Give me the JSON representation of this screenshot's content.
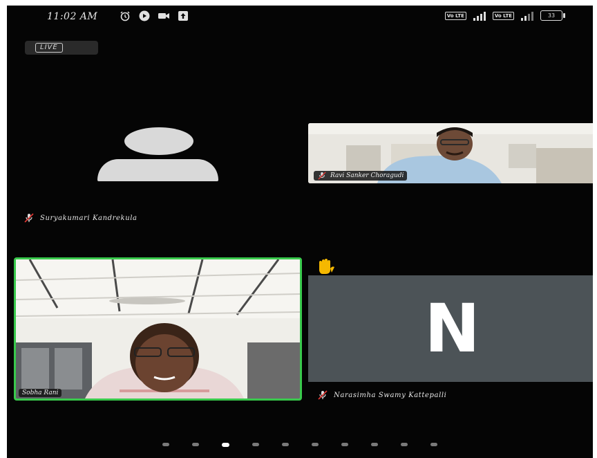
{
  "status_bar": {
    "time": "11:02 AM",
    "icons_left": [
      "alarm-icon",
      "youtube-icon",
      "video-camera-icon",
      "upload-icon"
    ],
    "battery": "33"
  },
  "live_badge": "LIVE",
  "participants": [
    {
      "name": "Suryakumari Kandrekula",
      "video": false,
      "muted": true
    },
    {
      "name": "Ravi Sanker Choragudi",
      "video": true,
      "muted": true
    },
    {
      "name": "Sobha Rani",
      "video": true,
      "muted": false,
      "active_speaker": true
    },
    {
      "name": "Narasimha Swamy Kattepalli",
      "video": false,
      "muted": true,
      "initial": "N",
      "hand_raised": true
    }
  ],
  "pagination": {
    "pages": 10,
    "active_index": 2
  },
  "colors": {
    "background": "#050505",
    "active_speaker_border": "#39c94c",
    "initial_tile": "#4c5357",
    "raise_hand": "#f5b800"
  }
}
